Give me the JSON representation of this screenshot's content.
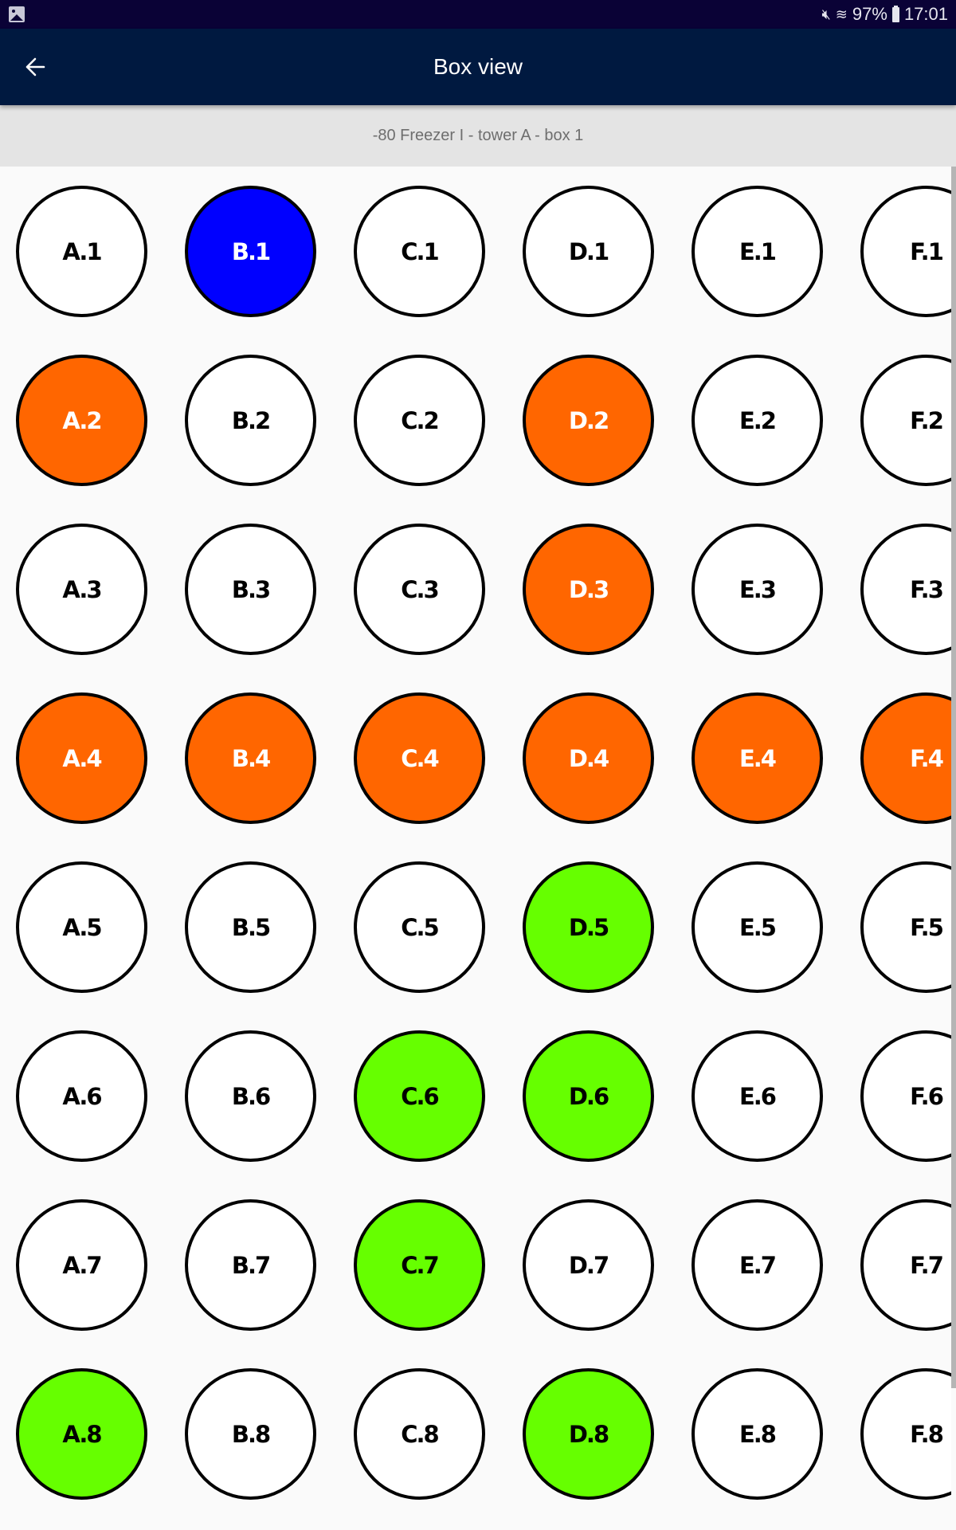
{
  "status_bar": {
    "left_icon": "image-icon",
    "icons": [
      "mute-icon",
      "wifi-icon"
    ],
    "battery": "97%",
    "time": "17:01"
  },
  "app_bar": {
    "back_icon": "arrow-left-icon",
    "title": "Box view"
  },
  "location": "-80 Freezer I - tower A - box 1",
  "colors": {
    "empty": "#ffffff",
    "selected": "#0000ff",
    "orange": "#ff6600",
    "green": "#66ff00",
    "border": "#000000"
  },
  "grid": {
    "columns": [
      "A",
      "B",
      "C",
      "D",
      "E",
      "F"
    ],
    "rows": 8,
    "wells": [
      {
        "label": "A.1",
        "state": "empty"
      },
      {
        "label": "B.1",
        "state": "selected"
      },
      {
        "label": "C.1",
        "state": "empty"
      },
      {
        "label": "D.1",
        "state": "empty"
      },
      {
        "label": "E.1",
        "state": "empty"
      },
      {
        "label": "F.1",
        "state": "empty"
      },
      {
        "label": "A.2",
        "state": "orange"
      },
      {
        "label": "B.2",
        "state": "empty"
      },
      {
        "label": "C.2",
        "state": "empty"
      },
      {
        "label": "D.2",
        "state": "orange"
      },
      {
        "label": "E.2",
        "state": "empty"
      },
      {
        "label": "F.2",
        "state": "empty"
      },
      {
        "label": "A.3",
        "state": "empty"
      },
      {
        "label": "B.3",
        "state": "empty"
      },
      {
        "label": "C.3",
        "state": "empty"
      },
      {
        "label": "D.3",
        "state": "orange"
      },
      {
        "label": "E.3",
        "state": "empty"
      },
      {
        "label": "F.3",
        "state": "empty"
      },
      {
        "label": "A.4",
        "state": "orange"
      },
      {
        "label": "B.4",
        "state": "orange"
      },
      {
        "label": "C.4",
        "state": "orange"
      },
      {
        "label": "D.4",
        "state": "orange"
      },
      {
        "label": "E.4",
        "state": "orange"
      },
      {
        "label": "F.4",
        "state": "orange"
      },
      {
        "label": "A.5",
        "state": "empty"
      },
      {
        "label": "B.5",
        "state": "empty"
      },
      {
        "label": "C.5",
        "state": "empty"
      },
      {
        "label": "D.5",
        "state": "green"
      },
      {
        "label": "E.5",
        "state": "empty"
      },
      {
        "label": "F.5",
        "state": "empty"
      },
      {
        "label": "A.6",
        "state": "empty"
      },
      {
        "label": "B.6",
        "state": "empty"
      },
      {
        "label": "C.6",
        "state": "green"
      },
      {
        "label": "D.6",
        "state": "green"
      },
      {
        "label": "E.6",
        "state": "empty"
      },
      {
        "label": "F.6",
        "state": "empty"
      },
      {
        "label": "A.7",
        "state": "empty"
      },
      {
        "label": "B.7",
        "state": "empty"
      },
      {
        "label": "C.7",
        "state": "green"
      },
      {
        "label": "D.7",
        "state": "empty"
      },
      {
        "label": "E.7",
        "state": "empty"
      },
      {
        "label": "F.7",
        "state": "empty"
      },
      {
        "label": "A.8",
        "state": "green"
      },
      {
        "label": "B.8",
        "state": "empty"
      },
      {
        "label": "C.8",
        "state": "empty"
      },
      {
        "label": "D.8",
        "state": "green"
      },
      {
        "label": "E.8",
        "state": "empty"
      },
      {
        "label": "F.8",
        "state": "empty"
      }
    ]
  }
}
